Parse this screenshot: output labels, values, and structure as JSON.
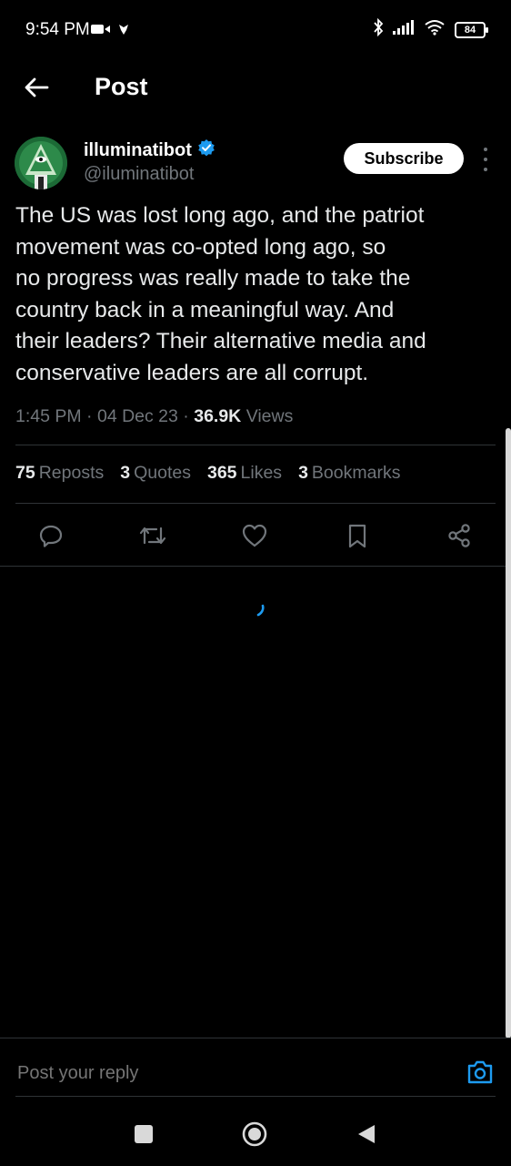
{
  "status_bar": {
    "time": "9:54 PM",
    "battery": "84",
    "left_icons": [
      "video-icon",
      "notification-icon"
    ],
    "right_icons": [
      "bluetooth-icon",
      "signal-icon",
      "wifi-icon",
      "battery-icon"
    ]
  },
  "header": {
    "title": "Post"
  },
  "post": {
    "author_name": "illuminatibot",
    "author_handle": "@iluminatibot",
    "subscribe_label": "Subscribe",
    "text": "The US was lost long ago, and the patriot\nmovement was co-opted long ago, so\nno progress was really made to take the\ncountry back in a meaningful way. And\ntheir leaders? Their alternative media and\nconservative leaders are all corrupt.",
    "time": "1:45 PM",
    "date": "04 Dec 23",
    "views_count": "36.9K",
    "views_label": "Views",
    "separator": "·"
  },
  "stats": {
    "reposts_count": "75",
    "reposts_label": "Reposts",
    "quotes_count": "3",
    "quotes_label": "Quotes",
    "likes_count": "365",
    "likes_label": "Likes",
    "bookmarks_count": "3",
    "bookmarks_label": "Bookmarks"
  },
  "reply": {
    "placeholder": "Post your reply"
  },
  "colors": {
    "background": "#000000",
    "text": "#e7e9ea",
    "secondary_text": "#71767b",
    "accent": "#1d9bf0",
    "divider": "#2f3336"
  }
}
